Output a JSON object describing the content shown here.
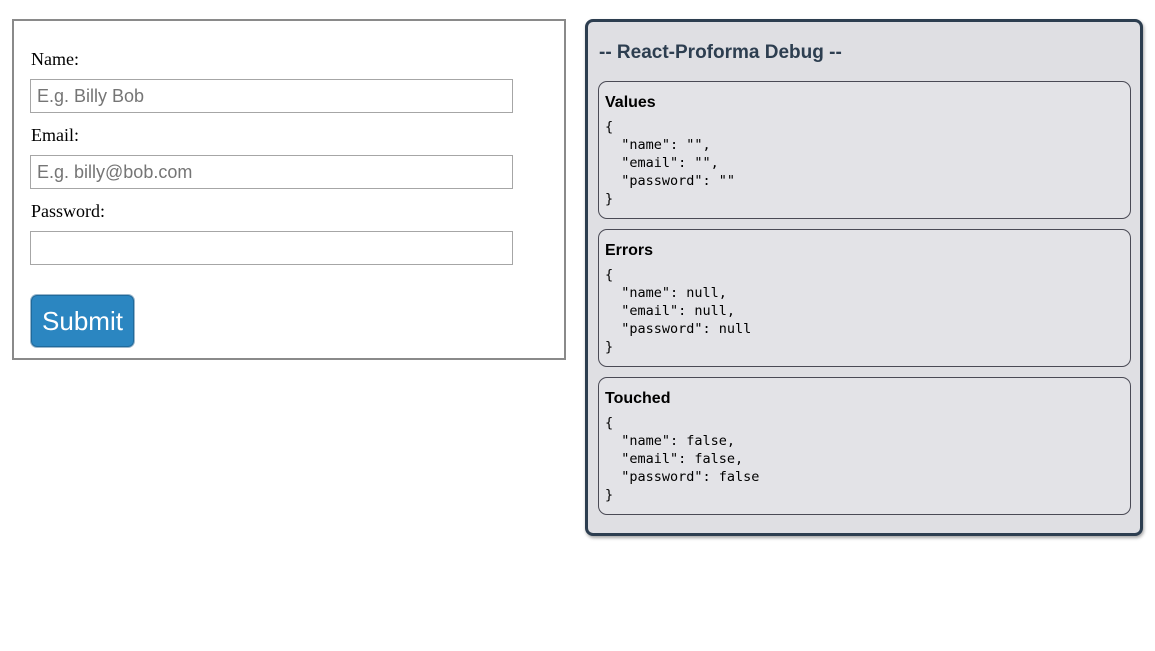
{
  "form": {
    "name_label": "Name:",
    "name_placeholder": "E.g. Billy Bob",
    "name_value": "",
    "email_label": "Email:",
    "email_placeholder": "E.g. billy@bob.com",
    "email_value": "",
    "password_label": "Password:",
    "password_placeholder": "",
    "password_value": "",
    "submit_label": "Submit",
    "submit_color": "#2b86c1"
  },
  "debug": {
    "title": "-- React-Proforma Debug --",
    "accent_color": "#2d3e50",
    "values": {
      "title": "Values",
      "lines": [
        "{",
        "  \"name\": \"\",",
        "  \"email\": \"\",",
        "  \"password\": \"\"",
        "}"
      ]
    },
    "errors": {
      "title": "Errors",
      "lines": [
        "{",
        "  \"name\": null,",
        "  \"email\": null,",
        "  \"password\": null",
        "}"
      ]
    },
    "touched": {
      "title": "Touched",
      "lines": [
        "{",
        "  \"name\": false,",
        "  \"email\": false,",
        "  \"password\": false",
        "}"
      ]
    }
  }
}
